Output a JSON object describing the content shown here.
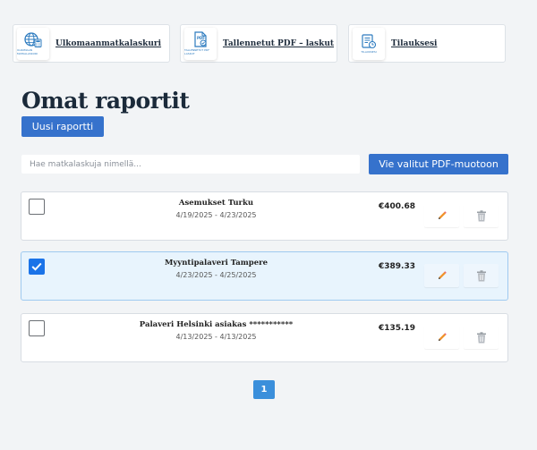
{
  "nav": [
    {
      "label": "Ulkomaanmatkalaskuri",
      "icon": "globe-calculator-icon",
      "caption": "ULKOMAAN MATKALASKURI"
    },
    {
      "label": "Tallennetut PDF – laskut",
      "icon": "pdf-document-icon",
      "caption": "TALLENNETUT PDF LASKUT"
    },
    {
      "label": "Tilauksesi",
      "icon": "subscription-icon",
      "caption": "TILAUKSESI"
    }
  ],
  "page": {
    "title": "Omat raportit",
    "new_report_label": "Uusi raportti",
    "search_placeholder": "Hae matkalaskuja nimellä...",
    "export_label": "Vie valitut PDF-muotoon"
  },
  "reports": [
    {
      "name": "Asemukset Turku",
      "dates": "4/19/2025 - 4/23/2025",
      "amount": "€400.68",
      "checked": false
    },
    {
      "name": "Myyntipalaveri Tampere",
      "dates": "4/23/2025 - 4/25/2025",
      "amount": "€389.33",
      "checked": true
    },
    {
      "name": "Palaveri Helsinki asiakas ***********",
      "dates": "4/13/2025 - 4/13/2025",
      "amount": "€135.19",
      "checked": false
    }
  ],
  "pagination": {
    "current": "1"
  },
  "colors": {
    "primary": "#3672cc",
    "checkbox_checked": "#1a73e8",
    "selected_row": "#e8f4fd",
    "edit_icon": "#f0932b",
    "delete_icon": "#9aa0a6"
  }
}
